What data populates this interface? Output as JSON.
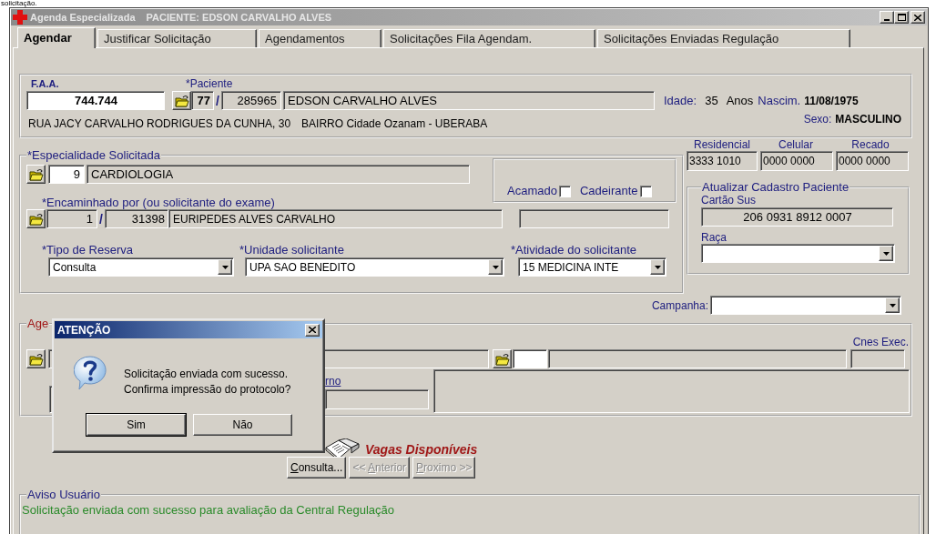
{
  "caption": "solicitação.",
  "window": {
    "title": "Agenda Especializada",
    "subtitle": "PACIENTE: EDSON CARVALHO ALVES"
  },
  "tabs": [
    {
      "label": "Agendar",
      "selected": true
    },
    {
      "label": "Justificar Solicitação",
      "selected": false
    },
    {
      "label": "Agendamentos",
      "selected": false
    },
    {
      "label": "Solicitações Fila Agendam.",
      "selected": false
    },
    {
      "label": "Solicitações Enviadas Regulação",
      "selected": false
    }
  ],
  "patient": {
    "faa_label": "F.A.A.",
    "faa": "744.744",
    "patient_label": "*Paciente",
    "unit": "77",
    "separator": "/",
    "code": "285965",
    "name": "EDSON CARVALHO ALVES",
    "age_label": "Idade:",
    "age": "35",
    "age_unit": "Anos",
    "birth_label": "Nascim.",
    "birth": "11/08/1975",
    "street": "RUA JACY CARVALHO RODRIGUES DA CUNHA, 30",
    "district": "BAIRRO Cidade Ozanam -  UBERABA",
    "sex_label": "Sexo:",
    "sex": "MASCULINO"
  },
  "especialidade": {
    "legend": "*Especialidade Solicitada",
    "code": "9",
    "name": "CARDIOLOGIA",
    "flags": [
      {
        "label": "Acamado",
        "checked": false
      },
      {
        "label": "Cadeirante",
        "checked": false
      }
    ],
    "referrer_label": "*Encaminhado por (ou solicitante do exame)",
    "referrer_unit": "1",
    "referrer_separator": "/",
    "referrer_code": "31398",
    "referrer_name": "EURIPEDES ALVES CARVALHO",
    "selects": [
      {
        "label": "*Tipo de Reserva",
        "value": "Consulta"
      },
      {
        "label": "*Unidade solicitante",
        "value": "UPA SAO BENEDITO"
      },
      {
        "label": "*Atividade do solicitante",
        "value": "15   MEDICINA INTE"
      }
    ]
  },
  "phones": [
    {
      "label": "Residencial",
      "value": "3333 1010"
    },
    {
      "label": "Celular",
      "value": "0000 0000"
    },
    {
      "label": "Recado",
      "value": "0000 0000"
    }
  ],
  "cadastro": {
    "legend": "Atualizar Cadastro Paciente",
    "card_label": "Cartão Sus",
    "card": "206 0931 8912 0007",
    "race_label": "Raça"
  },
  "campaign_label": "Campanha:",
  "agenda": {
    "legend": "Age",
    "cnes_label": "Cnes Exec.",
    "field_label": "rno"
  },
  "dialog": {
    "title": "ATENÇÃO",
    "lines": [
      "Solicitação enviada com sucesso.",
      "Confirma impressão do protocolo?"
    ],
    "buttons": [
      {
        "label": "Sim",
        "default": true
      },
      {
        "label": "Não",
        "default": false
      }
    ]
  },
  "vagas": "Vagas Disponíveis",
  "nav_buttons": [
    {
      "mnemonic": "C",
      "rest": "onsulta...",
      "disabled": false
    },
    {
      "prefix": "<< ",
      "mnemonic": "A",
      "rest": "nterior",
      "disabled": true
    },
    {
      "mnemonic": "P",
      "rest": "roximo >>",
      "disabled": true
    }
  ],
  "aviso": {
    "legend": "Aviso Usuário",
    "message": "Solicitação enviada com sucesso para avaliação da Central Regulação"
  }
}
